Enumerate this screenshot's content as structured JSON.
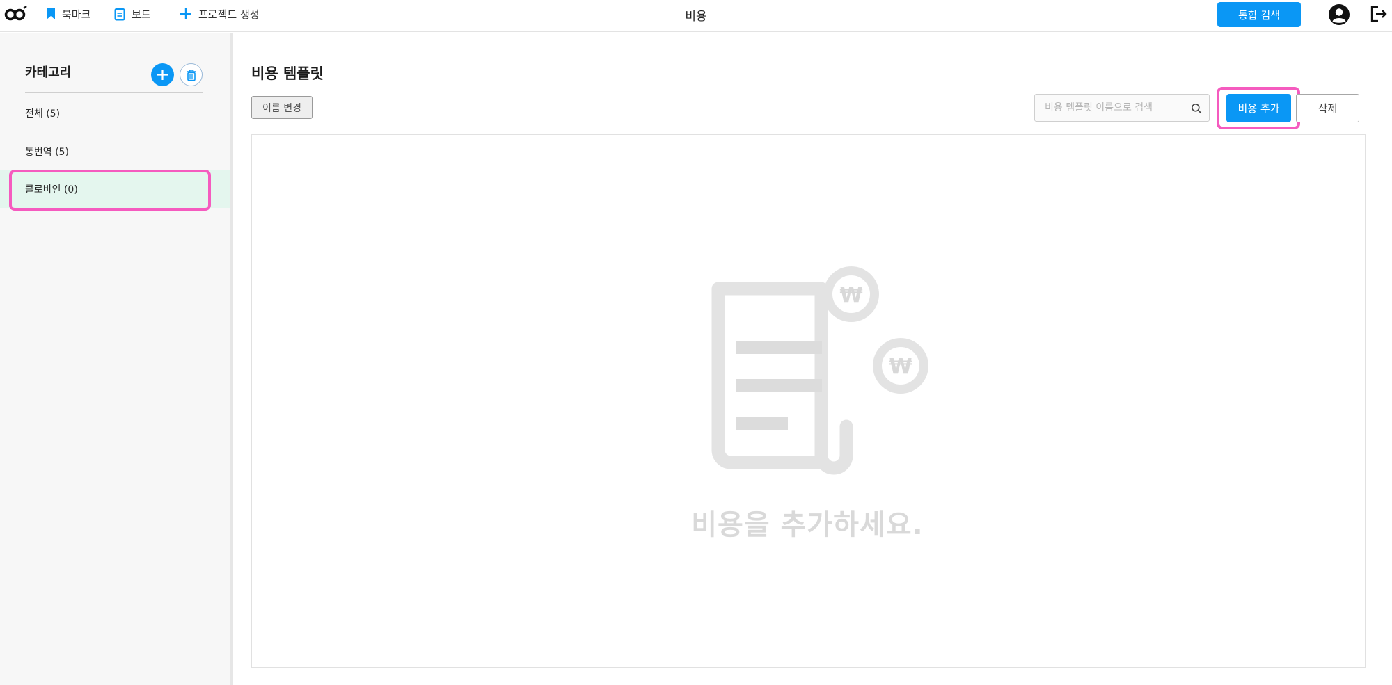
{
  "topbar": {
    "nav": [
      {
        "label": "북마크",
        "icon": "bookmark-icon"
      },
      {
        "label": "보드",
        "icon": "clipboard-icon"
      },
      {
        "label": "프로젝트 생성",
        "icon": "plus-icon"
      }
    ],
    "page_title": "비용",
    "global_search_label": "통합 검색"
  },
  "sidebar": {
    "header": "카테고리",
    "items": [
      {
        "label": "전체 (5)",
        "selected": false
      },
      {
        "label": "통번역 (5)",
        "selected": false
      },
      {
        "label": "클로바인 (0)",
        "selected": true
      }
    ]
  },
  "main": {
    "title": "비용 템플릿",
    "rename_label": "이름 변경",
    "search_placeholder": "비용 템플릿 이름으로 검색",
    "add_label": "비용 추가",
    "delete_label": "삭제",
    "empty_message": "비용을 추가하세요."
  },
  "colors": {
    "accent": "#0a97f5",
    "highlight": "#f55bbf",
    "selected_bg": "#e4f6ee"
  }
}
